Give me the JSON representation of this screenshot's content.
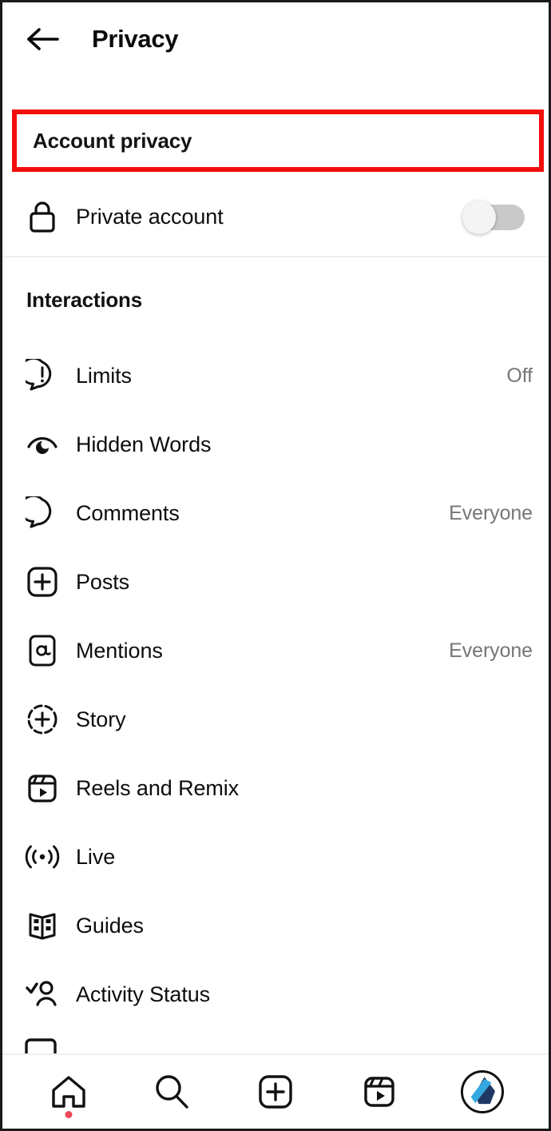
{
  "header": {
    "back_icon": "arrow-left-icon",
    "title": "Privacy"
  },
  "account_privacy": {
    "section_title": "Account privacy",
    "highlight_color": "#f40d0d",
    "private_account": {
      "icon": "lock-icon",
      "label": "Private account",
      "toggle_state": "off"
    }
  },
  "interactions": {
    "section_title": "Interactions",
    "items": [
      {
        "icon": "limits-icon",
        "label": "Limits",
        "value": "Off"
      },
      {
        "icon": "hidden-words-icon",
        "label": "Hidden Words",
        "value": ""
      },
      {
        "icon": "comment-bubble-icon",
        "label": "Comments",
        "value": "Everyone"
      },
      {
        "icon": "posts-plus-icon",
        "label": "Posts",
        "value": ""
      },
      {
        "icon": "mention-at-icon",
        "label": "Mentions",
        "value": "Everyone"
      },
      {
        "icon": "story-plus-icon",
        "label": "Story",
        "value": ""
      },
      {
        "icon": "reels-icon",
        "label": "Reels and Remix",
        "value": ""
      },
      {
        "icon": "live-broadcast-icon",
        "label": "Live",
        "value": ""
      },
      {
        "icon": "guides-book-icon",
        "label": "Guides",
        "value": ""
      },
      {
        "icon": "activity-status-icon",
        "label": "Activity Status",
        "value": ""
      }
    ]
  },
  "bottom_nav": {
    "items": [
      {
        "icon": "home-icon",
        "label": "Home",
        "badge": true
      },
      {
        "icon": "search-icon",
        "label": "Search",
        "badge": false
      },
      {
        "icon": "create-icon",
        "label": "Create",
        "badge": false
      },
      {
        "icon": "reels-nav-icon",
        "label": "Reels",
        "badge": false
      },
      {
        "icon": "profile-avatar-icon",
        "label": "Profile",
        "badge": false
      }
    ],
    "avatar_colors": {
      "dark": "#1f3864",
      "light": "#35a8e0"
    }
  }
}
